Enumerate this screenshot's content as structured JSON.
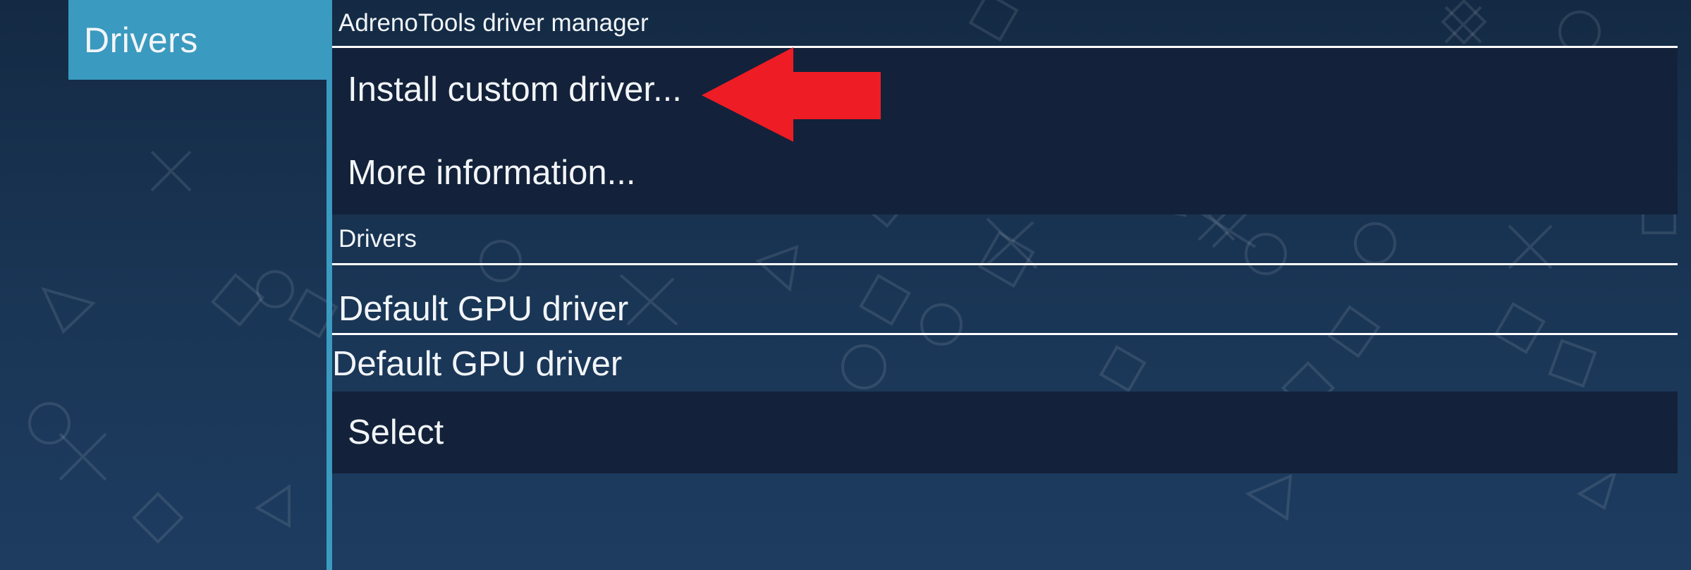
{
  "sidebar": {
    "active_tab": "Drivers"
  },
  "sections": [
    {
      "header": "AdrenoTools driver manager",
      "items": [
        "Install custom driver...",
        "More information..."
      ]
    },
    {
      "header": "Drivers",
      "current_driver": "Default GPU driver",
      "driver_row": "Default GPU driver",
      "action": "Select"
    }
  ],
  "annotation": {
    "arrow_color": "#ee1c25",
    "target": "Install custom driver..."
  },
  "colors": {
    "accent": "#3a9ac0",
    "background": "#183150",
    "row_dark": "#13223a"
  }
}
